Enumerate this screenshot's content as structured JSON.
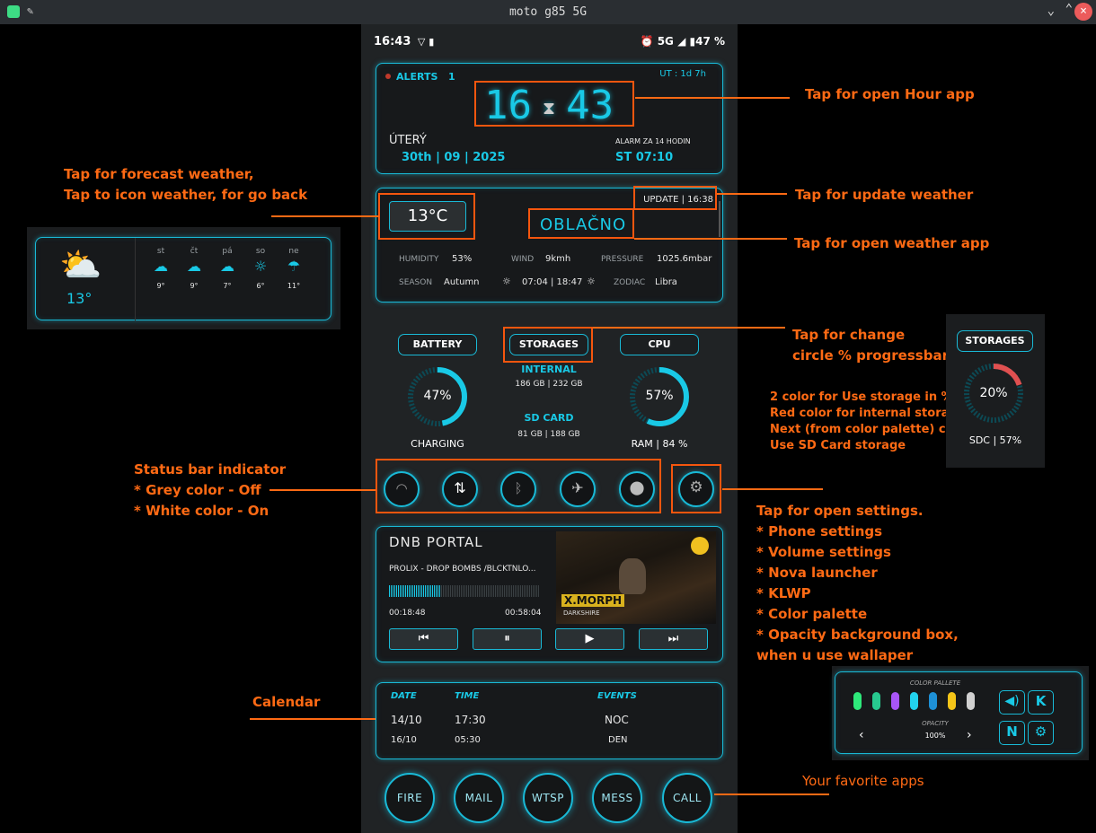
{
  "window": {
    "title": "moto g85 5G"
  },
  "statusbar": {
    "time": "16:43",
    "right": "5G ◢ ▮47 %"
  },
  "clock": {
    "alerts_label": "ALERTS",
    "alerts_count": "1",
    "uptime": "UT : 1d 7h",
    "hours": "16",
    "minutes": "43",
    "day": "ÚTERÝ",
    "date": "30th | 09 | 2025",
    "alarm_label": "ALARM ZA 14 HODIN",
    "alarm_time": "ST 07:10"
  },
  "weather": {
    "temp": "13°C",
    "update": "UPDATE | 16:38",
    "condition": "OBLAČNO",
    "humidity_label": "HUMIDITY",
    "humidity": "53%",
    "wind_label": "WIND",
    "wind": "9kmh",
    "pressure_label": "PRESSURE",
    "pressure": "1025.6mbar",
    "season_label": "SEASON",
    "season": "Autumn",
    "sun": "07:04 | 18:47",
    "zodiac_label": "ZODIAC",
    "zodiac": "Libra"
  },
  "forecast": {
    "temp": "13°",
    "days": [
      {
        "day": "st",
        "temp": "9°"
      },
      {
        "day": "čt",
        "temp": "9°"
      },
      {
        "day": "pá",
        "temp": "7°"
      },
      {
        "day": "so",
        "temp": "6°"
      },
      {
        "day": "ne",
        "temp": "11°"
      }
    ]
  },
  "battery": {
    "label": "BATTERY",
    "percent": "47%",
    "status": "CHARGING",
    "value": 47
  },
  "storages": {
    "label": "STORAGES",
    "internal_label": "INTERNAL",
    "internal": "186 GB | 232 GB",
    "sd_label": "SD CARD",
    "sd": "81 GB | 188 GB"
  },
  "cpu": {
    "label": "CPU",
    "percent": "57%",
    "ram": "RAM | 84 %",
    "value": 57
  },
  "storage_popup": {
    "label": "STORAGES",
    "percent": "20%",
    "sdc": "SDC | 57%",
    "value": 20
  },
  "music": {
    "title": "DNB PORTAL",
    "track": "PROLIX - DROP BOMBS /BLCKTNLO...",
    "elapsed": "00:18:48",
    "total": "00:58:04",
    "art_title": "X.MORPH",
    "art_sub": "DARKSHIRE"
  },
  "calendar": {
    "headers": [
      "DATE",
      "TIME",
      "EVENTS"
    ],
    "rows": [
      {
        "date": "14/10",
        "time": "17:30",
        "event": "NOC"
      },
      {
        "date": "16/10",
        "time": "05:30",
        "event": "DEN"
      }
    ]
  },
  "apps": [
    "FIRE",
    "MAIL",
    "WTSP",
    "MESS",
    "CALL"
  ],
  "settings_popup": {
    "palette_label": "COLOR PALLETE",
    "opacity_label": "OPACITY",
    "opacity": "100%",
    "palette": [
      "#2ee87a",
      "#27c98f",
      "#a855f7",
      "#22d3ee",
      "#1e90d6",
      "#f5c518",
      "#d0d0d0"
    ],
    "btn_k": "K",
    "btn_n": "N"
  },
  "annotations": {
    "hour": "Tap for open Hour app",
    "forecast_1": "Tap for forecast weather,",
    "forecast_2": "Tap to icon weather, for go back",
    "update": "Tap for update weather",
    "weather_app": "Tap for open weather app",
    "circle_1": "Tap for change",
    "circle_2": "circle % progressbar",
    "storage_1": "2 color for Use storage in %",
    "storage_2": "Red color for internal storage",
    "storage_3": "Next (from color palette) color for",
    "storage_4": "Use SD Card storage",
    "status_1": "Status bar indicator",
    "status_2": "* Grey color - Off",
    "status_3": "* White color - On",
    "settings_1": "Tap for open settings.",
    "settings_2": "* Phone settings",
    "settings_3": "* Volume settings",
    "settings_4": "* Nova launcher",
    "settings_5": "* KLWP",
    "settings_6": "* Color palette",
    "settings_7": "* Opacity background box,",
    "settings_8": "when u use wallaper",
    "calendar": "Calendar",
    "favorite": "Your favorite apps"
  }
}
